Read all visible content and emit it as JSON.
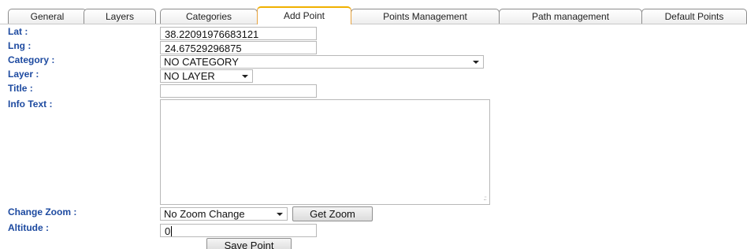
{
  "tabs": [
    {
      "label": "General"
    },
    {
      "label": "Layers"
    },
    {
      "label": "Categories"
    },
    {
      "label": "Add Point"
    },
    {
      "label": "Points Management"
    },
    {
      "label": "Path management"
    },
    {
      "label": "Default Points"
    }
  ],
  "active_tab": "Add Point",
  "form": {
    "lat": {
      "label": "Lat :",
      "value": "38.22091976683121"
    },
    "lng": {
      "label": "Lng :",
      "value": "24.67529296875"
    },
    "category": {
      "label": "Category :",
      "value": "NO CATEGORY"
    },
    "layer": {
      "label": "Layer :",
      "value": "NO LAYER"
    },
    "title": {
      "label": "Title :",
      "value": ""
    },
    "info_text": {
      "label": "Info Text :",
      "value": ""
    },
    "change_zoom": {
      "label": "Change Zoom :",
      "value": "No Zoom Change",
      "button": "Get Zoom"
    },
    "altitude": {
      "label": "Altitude :",
      "value": "0"
    },
    "save_button": "Save Point"
  },
  "colors": {
    "label": "#1d4aa0",
    "active_tab_accent": "#f0b000"
  }
}
